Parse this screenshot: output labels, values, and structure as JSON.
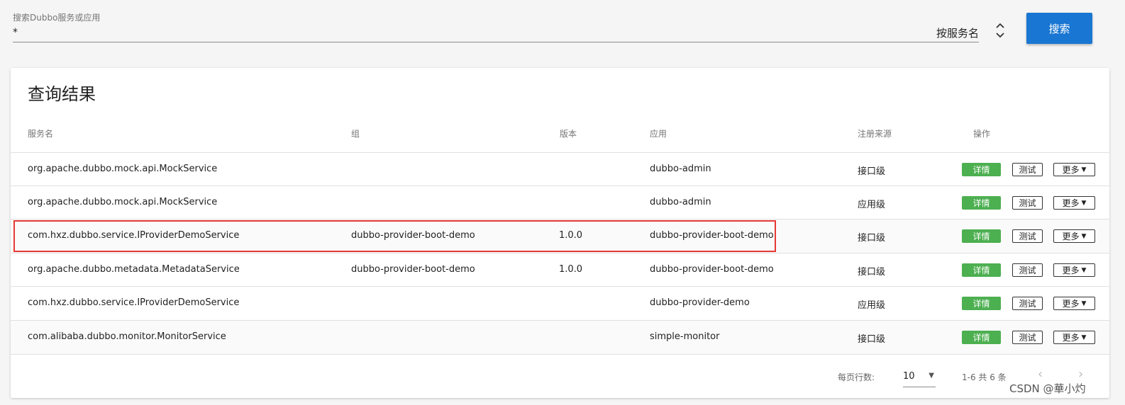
{
  "search": {
    "label": "搜索Dubbo服务或应用",
    "value": "*",
    "type_label": "按服务名",
    "button_label": "搜索"
  },
  "results": {
    "title": "查询结果",
    "columns": [
      "服务名",
      "组",
      "版本",
      "应用",
      "注册来源",
      "操作"
    ],
    "rows": [
      {
        "service": "org.apache.dubbo.mock.api.MockService",
        "group": "",
        "version": "",
        "app": "dubbo-admin",
        "source": "接口级"
      },
      {
        "service": "org.apache.dubbo.mock.api.MockService",
        "group": "",
        "version": "",
        "app": "dubbo-admin",
        "source": "应用级"
      },
      {
        "service": "com.hxz.dubbo.service.IProviderDemoService",
        "group": "dubbo-provider-boot-demo",
        "version": "1.0.0",
        "app": "dubbo-provider-boot-demo",
        "source": "接口级"
      },
      {
        "service": "org.apache.dubbo.metadata.MetadataService",
        "group": "dubbo-provider-boot-demo",
        "version": "1.0.0",
        "app": "dubbo-provider-boot-demo",
        "source": "接口级"
      },
      {
        "service": "com.hxz.dubbo.service.IProviderDemoService",
        "group": "",
        "version": "",
        "app": "dubbo-provider-demo",
        "source": "应用级"
      },
      {
        "service": "com.alibaba.dubbo.monitor.MonitorService",
        "group": "",
        "version": "",
        "app": "simple-monitor",
        "source": "接口级"
      }
    ],
    "actions": {
      "detail": "详情",
      "test": "测试",
      "more": "更多"
    }
  },
  "pagination": {
    "rows_per_page_label": "每页行数:",
    "rows_per_page": "10",
    "range": "1-6 共 6 条"
  },
  "watermark": "CSDN @華小灼",
  "colors": {
    "primary": "#1976d2",
    "detail": "#4caf50",
    "highlight": "#e53935"
  }
}
